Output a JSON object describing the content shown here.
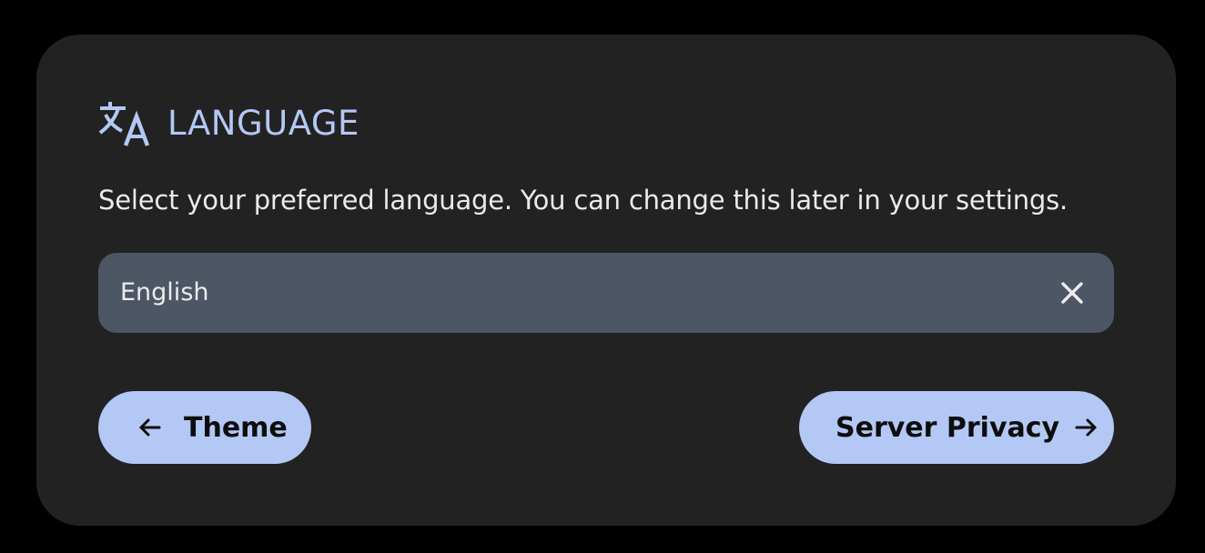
{
  "section": {
    "icon": "translate-icon",
    "title": "LANGUAGE",
    "description": "Select your preferred language. You can change this later in your settings."
  },
  "language_select": {
    "selected": "English",
    "clear_icon": "close-icon"
  },
  "navigation": {
    "back_label": "Theme",
    "back_icon": "arrow-left-icon",
    "next_label": "Server Privacy",
    "next_icon": "arrow-right-icon"
  },
  "colors": {
    "background": "#000000",
    "card": "#222222",
    "accent": "#b3c8f5",
    "input_bg": "#4d5665",
    "text": "#eaeaea"
  }
}
